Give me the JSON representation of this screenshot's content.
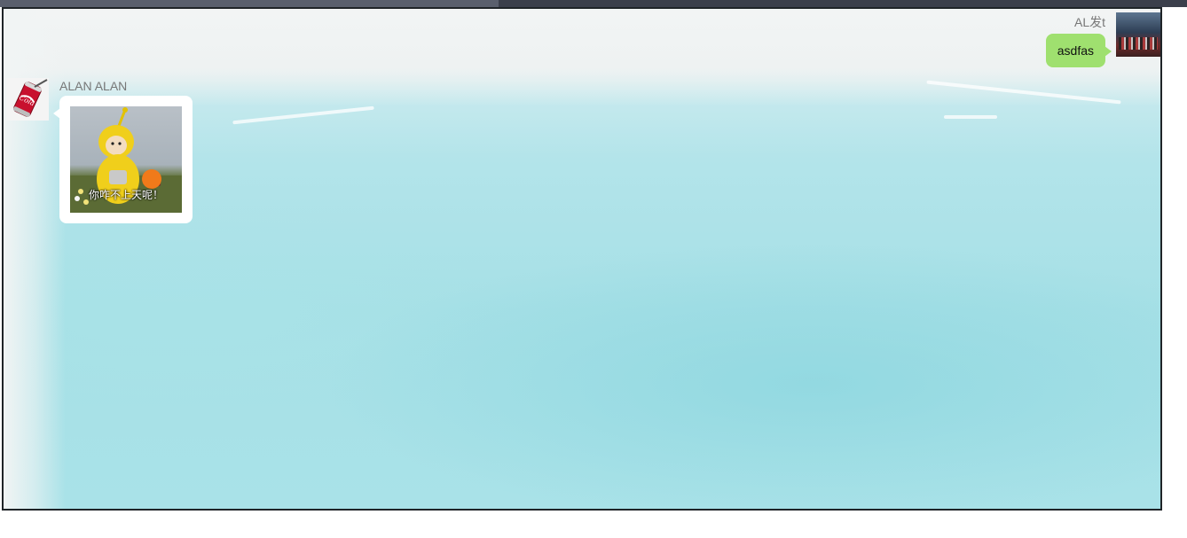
{
  "window": {
    "top_bar_progress": 0.42
  },
  "messages": [
    {
      "side": "right",
      "sender": "AL发t",
      "text": "asdfas",
      "bubble_color": "#9fe06f"
    },
    {
      "side": "left",
      "sender": "ALAN ALAN",
      "sticker": {
        "caption": "你咋不上天呢！"
      },
      "bubble_color": "#ffffff"
    }
  ],
  "avatars": {
    "right": "group-photo-avatar",
    "left": "cola-can-avatar"
  },
  "colors": {
    "frame_border": "#1f2428",
    "top_bar": "#3b3f4b",
    "name_text": "#777777",
    "background_wash": "#a6e0e6"
  }
}
